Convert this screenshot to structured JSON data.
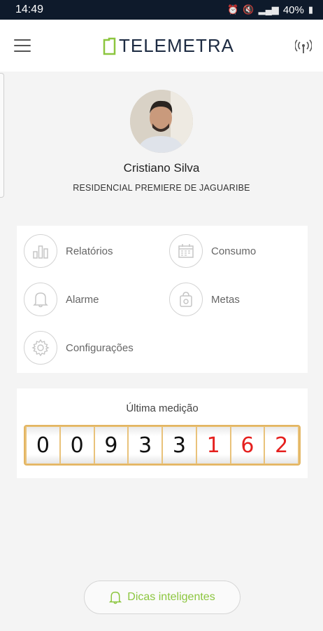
{
  "status_bar": {
    "time": "14:49",
    "battery": "40%"
  },
  "app": {
    "logo_text": "TELEMETRA",
    "brand_color": "#8cc63f"
  },
  "user": {
    "name": "Cristiano Silva",
    "place": "RESIDENCIAL PREMIERE DE JAGUARIBE"
  },
  "menu": {
    "items": [
      {
        "label": "Relatórios",
        "icon": "bar-chart-icon"
      },
      {
        "label": "Consumo",
        "icon": "calendar-icon"
      },
      {
        "label": "Alarme",
        "icon": "bell-icon"
      },
      {
        "label": "Metas",
        "icon": "target-bag-icon"
      },
      {
        "label": "Configurações",
        "icon": "gear-icon"
      }
    ]
  },
  "reading": {
    "title": "Última medição",
    "digits": [
      "0",
      "0",
      "9",
      "3",
      "3",
      "1",
      "6",
      "2"
    ],
    "highlight_color": "#e5201e"
  },
  "tips": {
    "label": "Dicas inteligentes",
    "icon": "bell-icon"
  }
}
